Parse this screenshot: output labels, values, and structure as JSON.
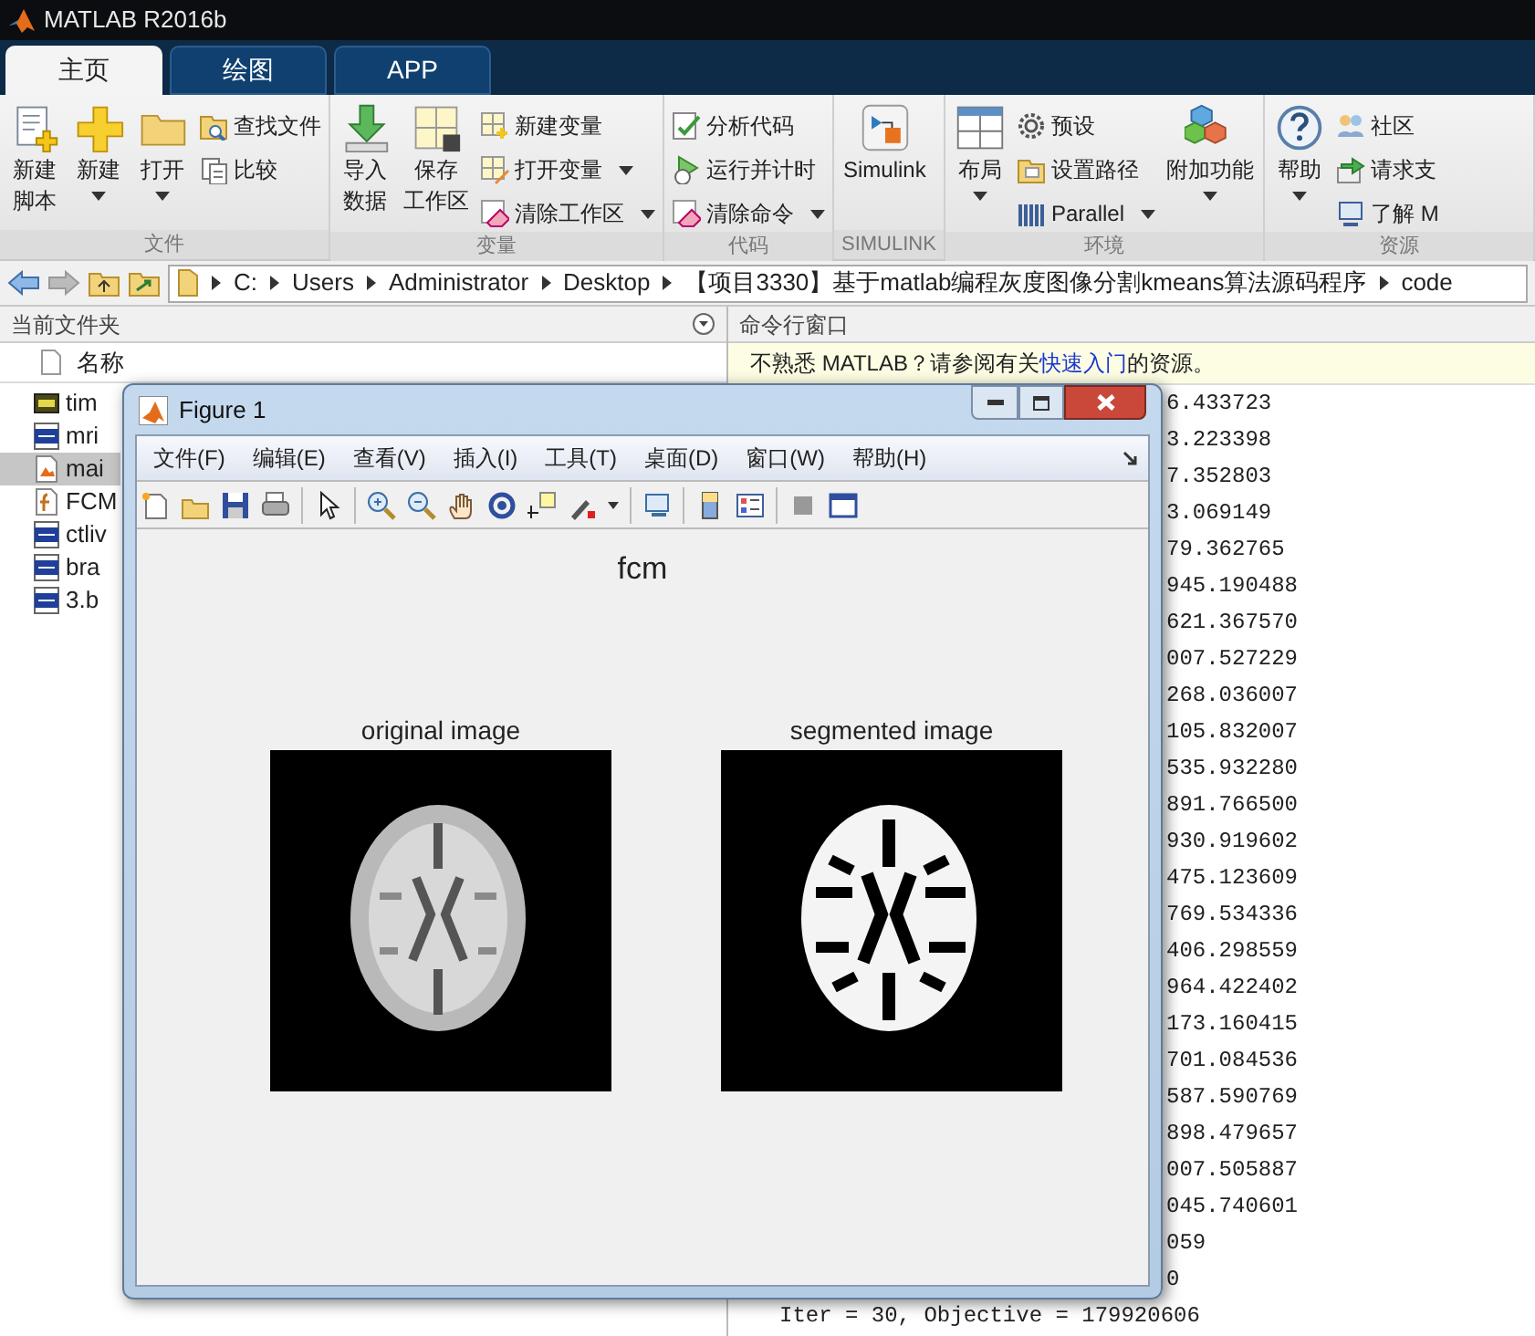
{
  "window": {
    "title": "MATLAB R2016b"
  },
  "tabs": [
    {
      "label": "主页",
      "selected": true
    },
    {
      "label": "绘图",
      "selected": false
    },
    {
      "label": "APP",
      "selected": false
    }
  ],
  "ribbon": {
    "sections": [
      {
        "label": "文件",
        "columns": [
          {
            "kind": "large",
            "label_lines": [
              "新建",
              "脚本"
            ],
            "dropdown": false
          },
          {
            "kind": "large",
            "label": "新建",
            "dropdown": true
          },
          {
            "kind": "large",
            "label": "打开",
            "dropdown": true
          },
          {
            "kind": "stack",
            "items": [
              {
                "label": "查找文件",
                "dropdown": false
              },
              {
                "label": "比较",
                "dropdown": false
              }
            ]
          }
        ]
      },
      {
        "label": "变量",
        "columns": [
          {
            "kind": "large",
            "label_lines": [
              "导入",
              "数据"
            ],
            "dropdown": false
          },
          {
            "kind": "large",
            "label_lines": [
              "保存",
              "工作区"
            ],
            "dropdown": false
          },
          {
            "kind": "stack",
            "items": [
              {
                "label": "新建变量",
                "dropdown": false
              },
              {
                "label": "打开变量",
                "dropdown": true
              },
              {
                "label": "清除工作区",
                "dropdown": true
              }
            ]
          }
        ]
      },
      {
        "label": "代码",
        "columns": [
          {
            "kind": "stack",
            "items": [
              {
                "label": "分析代码",
                "dropdown": false
              },
              {
                "label": "运行并计时",
                "dropdown": false
              },
              {
                "label": "清除命令",
                "dropdown": true
              }
            ]
          }
        ]
      },
      {
        "label": "SIMULINK",
        "columns": [
          {
            "kind": "large",
            "label": "Simulink",
            "dropdown": false
          }
        ]
      },
      {
        "label": "环境",
        "columns": [
          {
            "kind": "large",
            "label": "布局",
            "dropdown": true
          },
          {
            "kind": "stack",
            "items": [
              {
                "label": "预设",
                "dropdown": false
              },
              {
                "label": "设置路径",
                "dropdown": false
              },
              {
                "label": "Parallel",
                "dropdown": true
              }
            ]
          },
          {
            "kind": "large",
            "label": "附加功能",
            "dropdown": true
          }
        ]
      },
      {
        "label": "资源",
        "columns": [
          {
            "kind": "large",
            "label": "帮助",
            "dropdown": true
          },
          {
            "kind": "stack",
            "items": [
              {
                "label": "社区",
                "dropdown": false
              },
              {
                "label": "请求支",
                "dropdown": false
              },
              {
                "label": "了解 M",
                "dropdown": false
              }
            ]
          }
        ]
      }
    ]
  },
  "address_bar": {
    "path": [
      "C:",
      "Users",
      "Administrator",
      "Desktop",
      "【项目3330】基于matlab编程灰度图像分割kmeans算法源码程序",
      "code"
    ]
  },
  "file_panel": {
    "title": "当前文件夹",
    "column": "名称",
    "files": [
      {
        "name": "tim",
        "kind": "jpg",
        "selected": false
      },
      {
        "name": "mri",
        "kind": "bmp",
        "selected": false
      },
      {
        "name": "mai",
        "kind": "script",
        "selected": true
      },
      {
        "name": "FCM",
        "kind": "function",
        "selected": false
      },
      {
        "name": "ctliv",
        "kind": "bmp",
        "selected": false
      },
      {
        "name": "bra",
        "kind": "bmp",
        "selected": false
      },
      {
        "name": "3.b",
        "kind": "bmp",
        "selected": false
      }
    ]
  },
  "command_window": {
    "title": "命令行窗口",
    "notice": {
      "before": "不熟悉 MATLAB？请参阅有关",
      "link": "快速入门",
      "after": "的资源。"
    },
    "lines": [
      "6.433723",
      "3.223398",
      "7.352803",
      "3.069149",
      "79.362765",
      "945.190488",
      "621.367570",
      "007.527229",
      "268.036007",
      "105.832007",
      "535.932280",
      "891.766500",
      "930.919602",
      "475.123609",
      "769.534336",
      "406.298559",
      "964.422402",
      "173.160415",
      "701.084536",
      "587.590769",
      "898.479657",
      "007.505887",
      "045.740601",
      "059",
      "0"
    ],
    "bottom_line": "Iter = 30, Objective = 179920606"
  },
  "figure": {
    "title": "Figure 1",
    "menus": [
      "文件(F)",
      "编辑(E)",
      "查看(V)",
      "插入(I)",
      "工具(T)",
      "桌面(D)",
      "窗口(W)",
      "帮助(H)"
    ],
    "plot_title": "fcm",
    "axes": [
      {
        "title": "original image",
        "kind": "original"
      },
      {
        "title": "segmented image",
        "kind": "segmented"
      }
    ]
  }
}
